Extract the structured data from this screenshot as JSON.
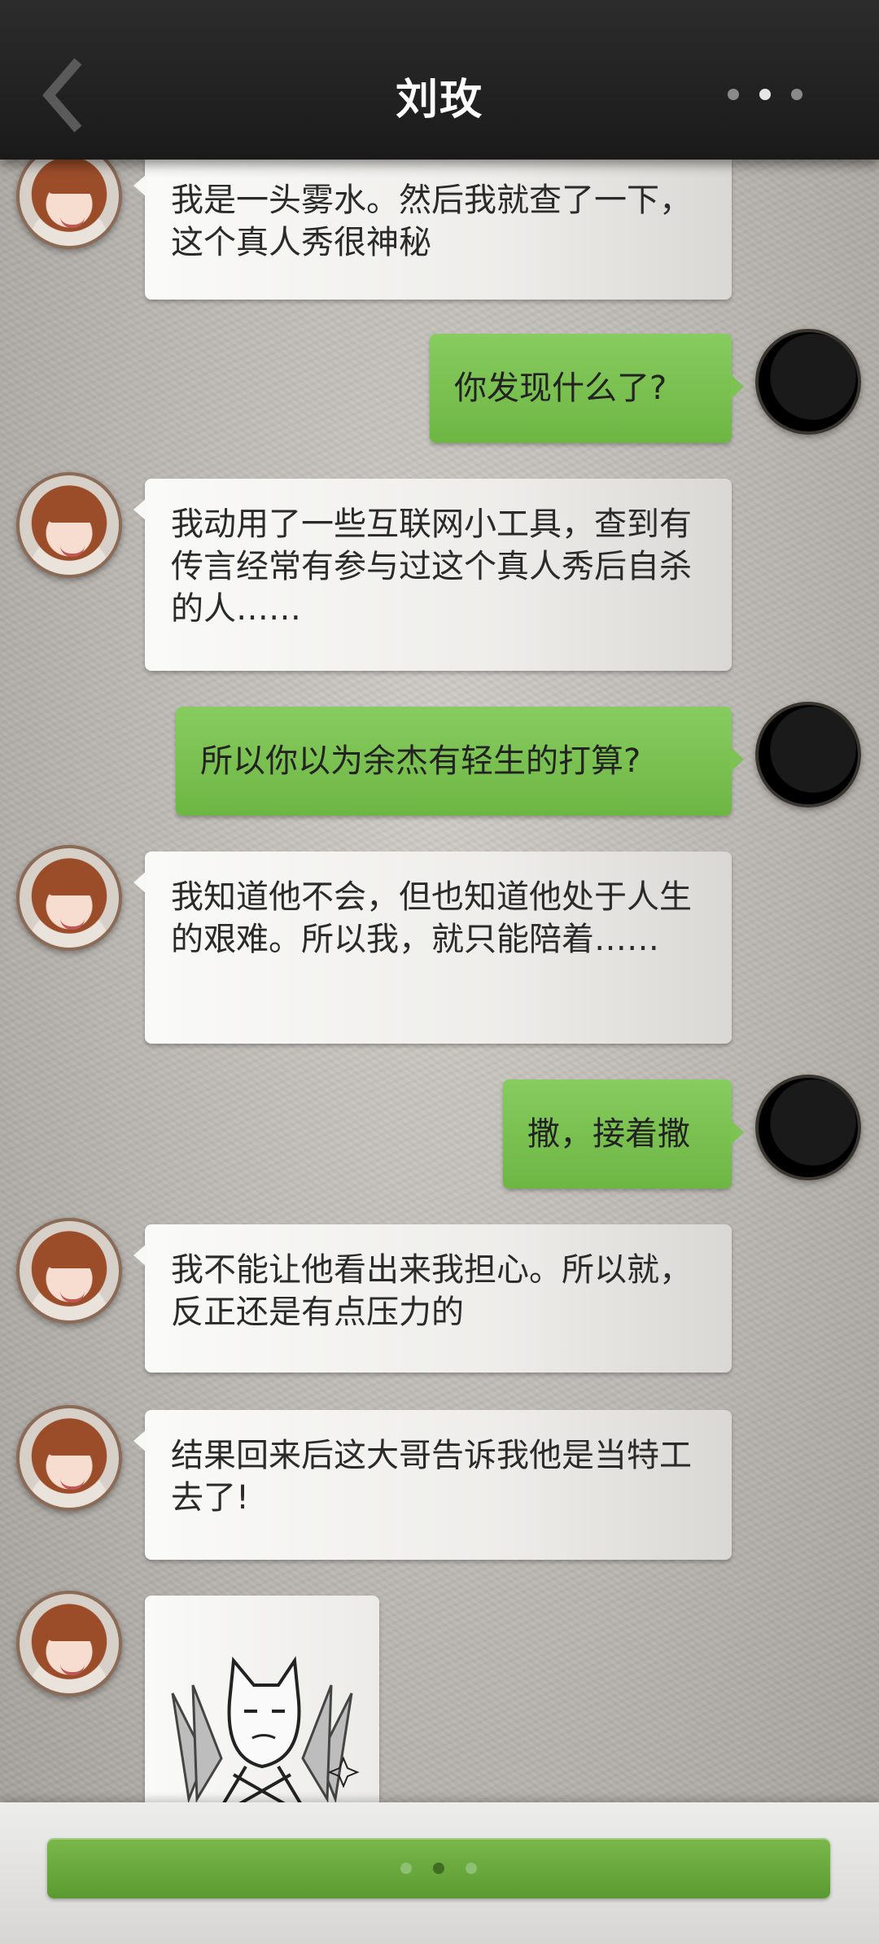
{
  "header": {
    "title": "刘玫",
    "back_icon": "chevron-left-icon",
    "more_icon": "more-dots-icon"
  },
  "messages": [
    {
      "from": "her",
      "text": "我是一头雾水。然后我就查了一下，这个真人秀很神秘"
    },
    {
      "from": "me",
      "text": "你发现什么了?"
    },
    {
      "from": "her",
      "text": "我动用了一些互联网小工具，查到有传言经常有参与过这个真人秀后自杀的人……"
    },
    {
      "from": "me",
      "text": "所以你以为余杰有轻生的打算?"
    },
    {
      "from": "her",
      "text": "我知道他不会，但也知道他处于人生的艰难。所以我，就只能陪着……"
    },
    {
      "from": "me",
      "text": "撒，接着撒"
    },
    {
      "from": "her",
      "text": "我不能让他看出来我担心。所以就，反正还是有点压力的"
    },
    {
      "from": "her",
      "text": "结果回来后这大哥告诉我他是当特工去了!"
    },
    {
      "from": "her",
      "sticker": "cat-meme-sticker"
    }
  ],
  "bottom_bar": {
    "continue_icon": "typing-dots-icon"
  },
  "colors": {
    "outgoing_bubble": "#7dc354",
    "incoming_bubble": "#f2f1ee",
    "topbar": "#222222",
    "accent_button": "#6aa83e"
  }
}
